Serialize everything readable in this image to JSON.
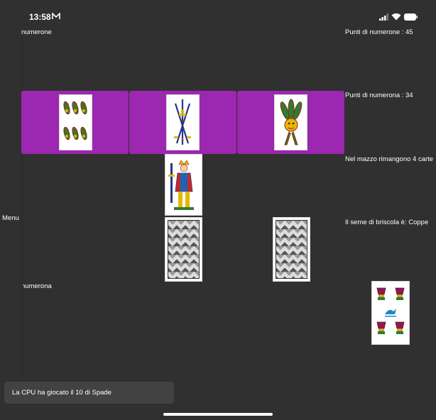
{
  "status_bar": {
    "time": "13:58"
  },
  "players": {
    "cpu_name": "numerone",
    "human_name": "numerona"
  },
  "scores": {
    "cpu_points": "Punti di numerone  : 45",
    "human_points": "Punti di numerona  : 34"
  },
  "deck": {
    "remaining": "Nel mazzo rimangono 4 carte",
    "trump": "Il seme di briscola è: Coppe"
  },
  "menu_label": "Menu",
  "toast": "La CPU ha giocato il 10 di Spade",
  "cards": {
    "hand_1": "6 di Bastoni",
    "hand_2": "3 di Spade",
    "hand_3": "Asso di Bastoni",
    "played": "10 di Spade",
    "briscola": "4 di Coppe"
  },
  "colors": {
    "background": "#303030",
    "hand_highlight": "#9c27b0",
    "toast": "#424242"
  }
}
